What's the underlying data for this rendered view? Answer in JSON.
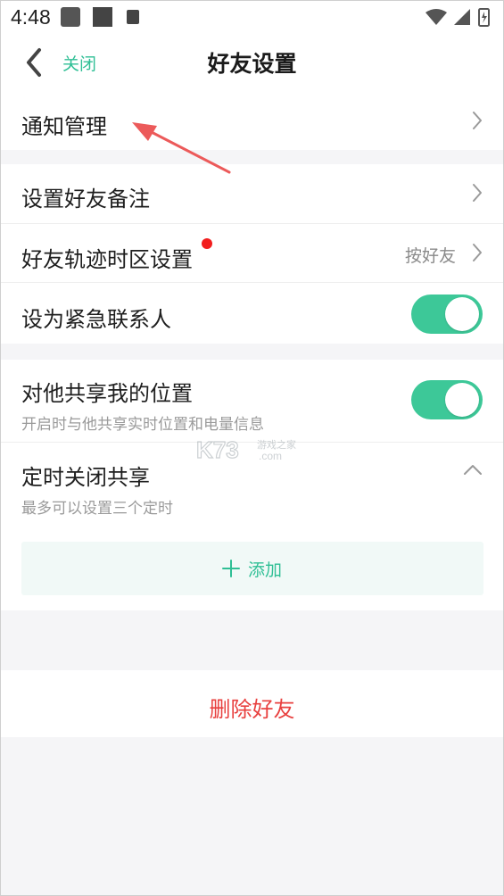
{
  "status_bar": {
    "time": "4:48"
  },
  "nav": {
    "back_label": "关闭",
    "title": "好友设置"
  },
  "rows": {
    "notification": {
      "label": "通知管理"
    },
    "remark": {
      "label": "设置好友备注"
    },
    "timezone": {
      "label": "好友轨迹时区设置",
      "value": "按好友"
    },
    "emergency": {
      "label": "设为紧急联系人",
      "toggle_on": true
    },
    "share_location": {
      "label": "对他共享我的位置",
      "subtitle": "开启时与他共享实时位置和电量信息",
      "toggle_on": true
    },
    "timed_close": {
      "label": "定时关闭共享",
      "subtitle": "最多可以设置三个定时"
    }
  },
  "add": {
    "label": "添加"
  },
  "delete": {
    "label": "删除好友"
  },
  "watermark": {
    "text": "K73 游戏之家 .com"
  },
  "colors": {
    "accent": "#3dc898",
    "danger": "#e8403f",
    "red_dot": "#f21e1e"
  }
}
